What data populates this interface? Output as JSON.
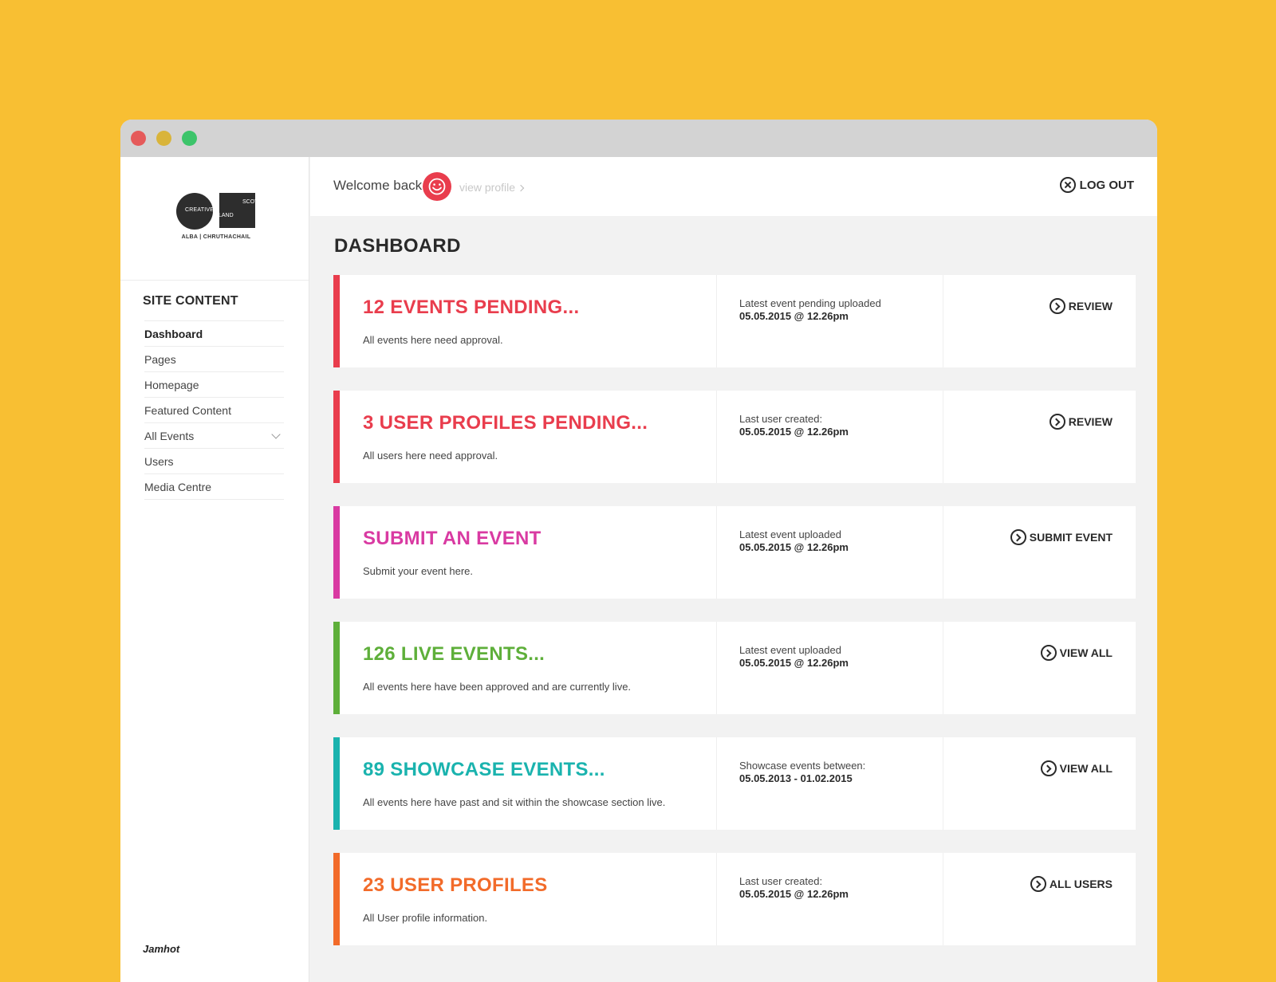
{
  "colors": {
    "background": "#F8BF33",
    "red": "#E93D4D",
    "magenta": "#D93AA2",
    "green": "#5EAF3A",
    "teal": "#1AB3AE",
    "orange": "#F26B2A"
  },
  "logo": {
    "word1": "CREATIVE",
    "word2": "SCOT",
    "word3": "LAND",
    "subtitle": "ALBA | CHRUTHACHAIL"
  },
  "sidebar": {
    "title": "SITE CONTENT",
    "items": [
      {
        "label": "Dashboard"
      },
      {
        "label": "Pages"
      },
      {
        "label": "Homepage"
      },
      {
        "label": "Featured Content"
      },
      {
        "label": "All Events"
      },
      {
        "label": "Users"
      },
      {
        "label": "Media Centre"
      }
    ],
    "footer": "Jamhot"
  },
  "header": {
    "welcome": "Welcome back",
    "view_profile": "view profile",
    "logout": "LOG OUT"
  },
  "page_title": "DASHBOARD",
  "cards": [
    {
      "title": "12 EVENTS PENDING...",
      "desc": "All events here need approval.",
      "meta_label": "Latest event pending uploaded",
      "meta_value": "05.05.2015 @ 12.26pm",
      "action": "REVIEW"
    },
    {
      "title": "3 USER PROFILES PENDING...",
      "desc": "All users here need approval.",
      "meta_label": "Last user created:",
      "meta_value": "05.05.2015 @ 12.26pm",
      "action": "REVIEW"
    },
    {
      "title": "SUBMIT AN EVENT",
      "desc": "Submit your event here.",
      "meta_label": "Latest event uploaded",
      "meta_value": "05.05.2015 @ 12.26pm",
      "action": "SUBMIT EVENT"
    },
    {
      "title": "126 LIVE EVENTS...",
      "desc": "All events here have been approved and are currently live.",
      "meta_label": "Latest event uploaded",
      "meta_value": "05.05.2015 @ 12.26pm",
      "action": "VIEW ALL"
    },
    {
      "title": "89 SHOWCASE EVENTS...",
      "desc": "All events here have past and sit within the showcase section live.",
      "meta_label": "Showcase events between:",
      "meta_value": "05.05.2013  -  01.02.2015",
      "action": "VIEW ALL"
    },
    {
      "title": "23 USER PROFILES",
      "desc": "All User profile information.",
      "meta_label": "Last user created:",
      "meta_value": "05.05.2015 @ 12.26pm",
      "action": "ALL USERS"
    }
  ]
}
